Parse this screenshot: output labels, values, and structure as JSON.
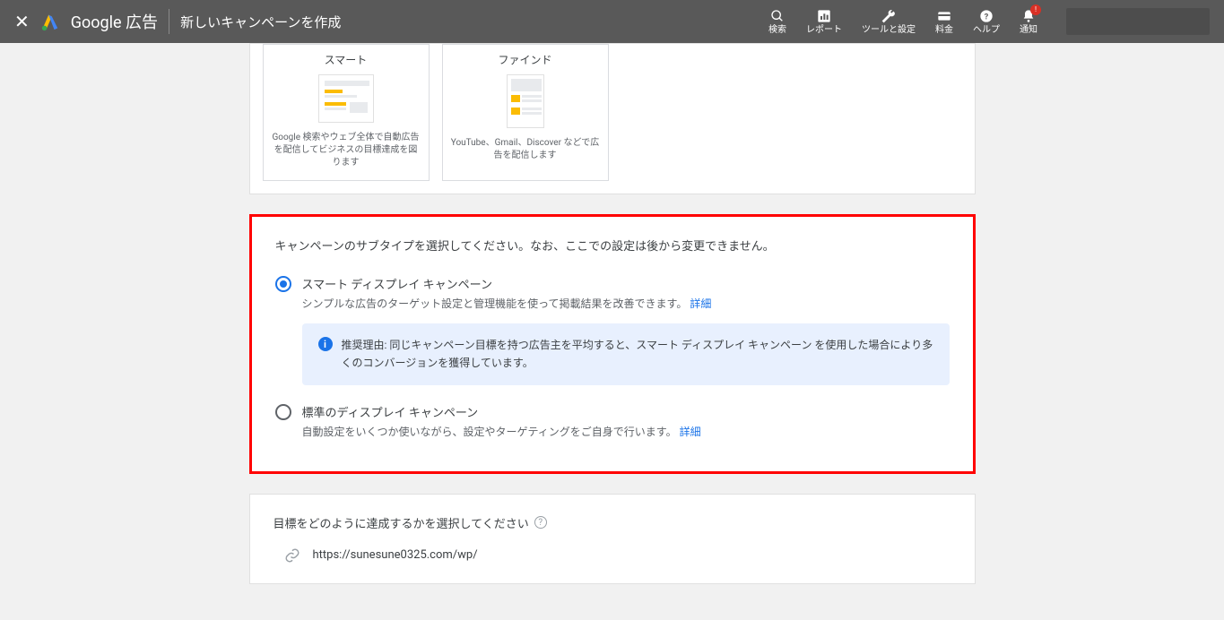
{
  "header": {
    "brand": "Google 広告",
    "page_title": "新しいキャンペーンを作成",
    "actions": {
      "search": "検索",
      "report": "レポート",
      "tools": "ツールと設定",
      "billing": "料金",
      "help": "ヘルプ",
      "notifications": "通知",
      "notification_badge": "!"
    }
  },
  "campaign_types": {
    "smart": {
      "title": "スマート",
      "description": "Google 検索やウェブ全体で自動広告を配信してビジネスの目標達成を図ります"
    },
    "find": {
      "title": "ファインド",
      "description": "YouTube、Gmail、Discover などで広告を配信します"
    }
  },
  "subtype": {
    "heading": "キャンペーンのサブタイプを選択してください。なお、ここでの設定は後から変更できません。",
    "option1": {
      "label": "スマート ディスプレイ キャンペーン",
      "description": "シンプルな広告のターゲット設定と管理機能を使って掲載結果を改善できます。",
      "detail_link": "詳細"
    },
    "recommendation": {
      "text": "推奨理由: 同じキャンペーン目標を持つ広告主を平均すると、スマート ディスプレイ キャンペーン を使用した場合により多くのコンバージョンを獲得しています。"
    },
    "option2": {
      "label": "標準のディスプレイ キャンペーン",
      "description": "自動設定をいくつか使いながら、設定やターゲティングをご自身で行います。",
      "detail_link": "詳細"
    }
  },
  "goal": {
    "heading": "目標をどのように達成するかを選択してください",
    "url": "https://sunesune0325.com/wp/"
  }
}
